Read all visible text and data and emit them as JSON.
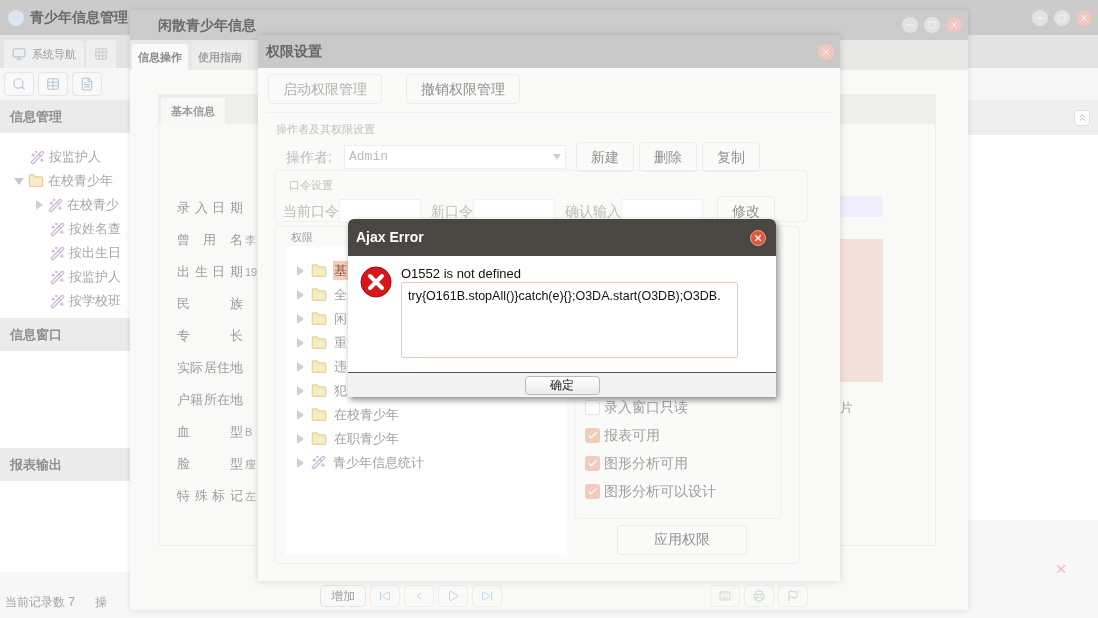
{
  "main_window": {
    "title": "青少年信息管理",
    "tabs": [
      {
        "kind": "text",
        "label": "系统导航"
      },
      {
        "kind": "icon"
      }
    ],
    "panels": [
      {
        "title": "信息管理",
        "tree": [
          {
            "kind": "query",
            "label": "按监护人"
          },
          {
            "kind": "folder",
            "label": "在校青少年",
            "expanded": true,
            "children": [
              {
                "kind": "group",
                "label": "在校青少",
                "expanded": false
              },
              {
                "kind": "query",
                "label": "按姓名查"
              },
              {
                "kind": "query",
                "label": "按出生日"
              },
              {
                "kind": "query",
                "label": "按监护人"
              },
              {
                "kind": "query",
                "label": "按学校班"
              }
            ]
          }
        ]
      },
      {
        "title": "信息窗口"
      },
      {
        "title": "报表输出"
      }
    ],
    "status_bar": [
      "当前记录数 7",
      "操"
    ]
  },
  "record_window": {
    "title": "闲散青少年信息",
    "tabs": [
      {
        "label": "信息操作",
        "selected": true
      },
      {
        "label": "使用指南",
        "selected": false
      }
    ],
    "inner_tab": "基本信息",
    "fields": [
      {
        "label": "录入日期"
      },
      {
        "label": "曾 用 名",
        "value": "李"
      },
      {
        "label": "出生日期",
        "value": "19"
      },
      {
        "label": "民 族"
      },
      {
        "label": "专 长"
      },
      {
        "label": "实际居住地"
      },
      {
        "label": "户籍所在地"
      },
      {
        "label": "血 型",
        "value": "B"
      },
      {
        "label": "脸 型",
        "value": "瘦"
      },
      {
        "label": "特殊标记",
        "value": "左"
      }
    ],
    "photo_caption": "片",
    "add_button": "增加"
  },
  "permissions_window": {
    "title": "权限设置",
    "buttons": [
      {
        "label": "启动权限管理",
        "disabled": true
      },
      {
        "label": "撤销权限管理",
        "disabled": false
      }
    ],
    "operator_group": {
      "title": "操作者及其权限设置",
      "label": "操作者:",
      "value": "Admin",
      "buttons": [
        "新建",
        "删除",
        "复制"
      ]
    },
    "password_group": {
      "title": "口令设置",
      "fields": [
        {
          "label": "当前口令"
        },
        {
          "label": "新口令"
        },
        {
          "label": "确认输入"
        }
      ],
      "button": "修改"
    },
    "permissions_group": {
      "title": "权限",
      "tree": [
        {
          "kind": "folder",
          "label": "基",
          "selected": true
        },
        {
          "kind": "folder",
          "label": "全",
          "selected": false
        },
        {
          "kind": "folder",
          "label": "闲",
          "selected": false
        },
        {
          "kind": "folder",
          "label": "重",
          "selected": false
        },
        {
          "kind": "folder",
          "label": "违",
          "selected": false
        },
        {
          "kind": "folder",
          "label": "犯",
          "selected": false
        },
        {
          "kind": "folder",
          "label": "在校青少年",
          "selected": false
        },
        {
          "kind": "folder",
          "label": "在职青少年",
          "selected": false
        },
        {
          "kind": "tool",
          "label": "青少年信息统计",
          "selected": false
        }
      ],
      "options": [
        {
          "label": "录入窗口只读",
          "checked": false
        },
        {
          "label": "报表可用",
          "checked": true
        },
        {
          "label": "图形分析可用",
          "checked": true
        },
        {
          "label": "图形分析可以设计",
          "checked": true
        }
      ],
      "apply_button": "应用权限"
    }
  },
  "error_dialog": {
    "title": "Ajax Error",
    "message": "O1552 is not defined",
    "detail": "try{O161B.stopAll()}catch(e){};O3DA.start(O3DB);O3DB.",
    "button": "确定"
  }
}
